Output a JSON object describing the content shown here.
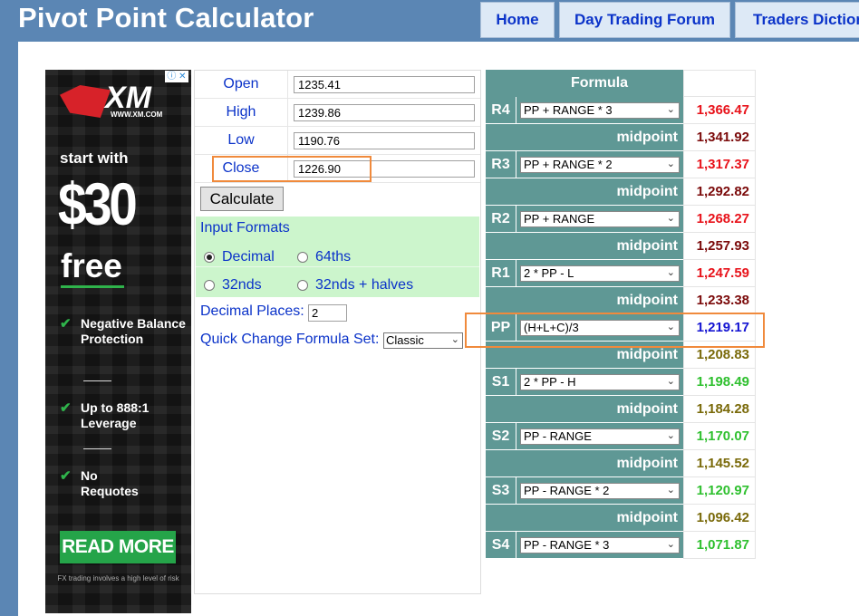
{
  "header": {
    "title": "Pivot Point Calculator",
    "nav": [
      "Home",
      "Day Trading Forum",
      "Traders Diction"
    ]
  },
  "ad": {
    "adchoice": "ⓘ ✕",
    "brand": "XM",
    "url": "WWW.XM.COM",
    "start_text": "start with",
    "amount": "$30",
    "free": "free",
    "bullets": [
      "Negative Balance Protection",
      "Up to 888:1 Leverage",
      "No Requotes"
    ],
    "button": "READ MORE",
    "disclaimer": "FX trading involves a high level of risk"
  },
  "inputs": {
    "fields": [
      {
        "label": "Open",
        "value": "1235.41"
      },
      {
        "label": "High",
        "value": "1239.86"
      },
      {
        "label": "Low",
        "value": "1190.76"
      },
      {
        "label": "Close",
        "value": "1226.90"
      }
    ],
    "calculate_label": "Calculate",
    "input_formats_title": "Input Formats",
    "formats": [
      {
        "label": "Decimal",
        "checked": true
      },
      {
        "label": "64ths",
        "checked": false
      },
      {
        "label": "32nds",
        "checked": false
      },
      {
        "label": "32nds + halves",
        "checked": false
      }
    ],
    "decimal_places_label": "Decimal Places:",
    "decimal_places_value": "2",
    "quick_change_label": "Quick Change Formula Set:",
    "quick_change_value": "Classic"
  },
  "formula_table": {
    "header": "Formula",
    "rows": [
      {
        "label": "R4",
        "formula": "PP + RANGE * 3",
        "value": "1,366.47",
        "color": "#e8121a"
      },
      {
        "label": "",
        "midpoint": "midpoint",
        "value": "1,341.92",
        "color": "#7b0a0a"
      },
      {
        "label": "R3",
        "formula": "PP + RANGE * 2",
        "value": "1,317.37",
        "color": "#e8121a"
      },
      {
        "label": "",
        "midpoint": "midpoint",
        "value": "1,292.82",
        "color": "#7b0a0a"
      },
      {
        "label": "R2",
        "formula": "PP + RANGE",
        "value": "1,268.27",
        "color": "#e8121a"
      },
      {
        "label": "",
        "midpoint": "midpoint",
        "value": "1,257.93",
        "color": "#7b0a0a"
      },
      {
        "label": "R1",
        "formula": "2 * PP - L",
        "value": "1,247.59",
        "color": "#e8121a"
      },
      {
        "label": "",
        "midpoint": "midpoint",
        "value": "1,233.38",
        "color": "#7b0a0a"
      },
      {
        "label": "PP",
        "formula": "(H+L+C)/3",
        "value": "1,219.17",
        "color": "#1414d2"
      },
      {
        "label": "",
        "midpoint": "midpoint",
        "value": "1,208.83",
        "color": "#7a6a0a"
      },
      {
        "label": "S1",
        "formula": "2 * PP - H",
        "value": "1,198.49",
        "color": "#2fc02f"
      },
      {
        "label": "",
        "midpoint": "midpoint",
        "value": "1,184.28",
        "color": "#7a6a0a"
      },
      {
        "label": "S2",
        "formula": "PP - RANGE",
        "value": "1,170.07",
        "color": "#2fc02f"
      },
      {
        "label": "",
        "midpoint": "midpoint",
        "value": "1,145.52",
        "color": "#7a6a0a"
      },
      {
        "label": "S3",
        "formula": "PP - RANGE * 2",
        "value": "1,120.97",
        "color": "#2fc02f"
      },
      {
        "label": "",
        "midpoint": "midpoint",
        "value": "1,096.42",
        "color": "#7a6a0a"
      },
      {
        "label": "S4",
        "formula": "PP - RANGE * 3",
        "value": "1,071.87",
        "color": "#2fc02f"
      }
    ]
  },
  "colors": {
    "header_bg": "#5b86b4",
    "table_teal": "#5f9895",
    "formats_bg": "#ccf5cc",
    "highlight": "#f08a3c",
    "link_blue": "#0b33c9"
  }
}
